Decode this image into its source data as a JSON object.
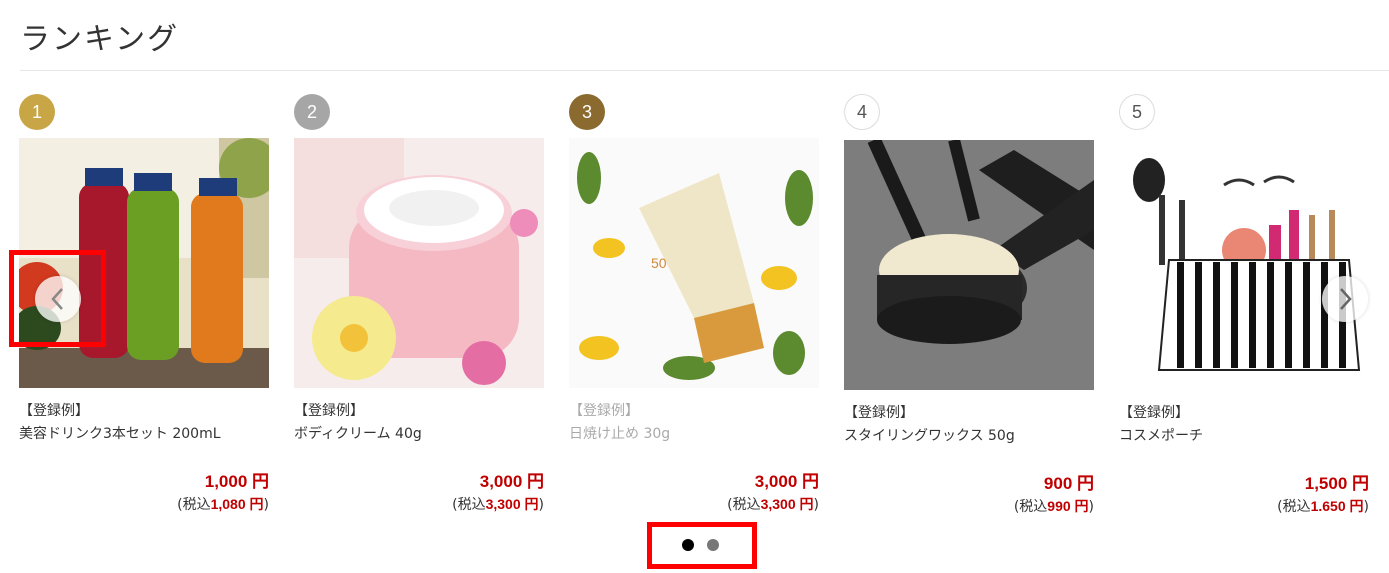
{
  "section": {
    "title": "ランキング"
  },
  "products": [
    {
      "rank": "1",
      "rank_color": "#c8a545",
      "tag": "【登録例】",
      "name": "美容ドリンク3本セット 200mL",
      "price": "1,000 円",
      "tax_prefix": "(税込",
      "tax_value": "1,080 円",
      "tax_suffix": ")"
    },
    {
      "rank": "2",
      "rank_color": "#a6a6a6",
      "tag": "【登録例】",
      "name": "ボディクリーム 40g",
      "price": "3,000 円",
      "tax_prefix": "(税込",
      "tax_value": "3,300 円",
      "tax_suffix": ")"
    },
    {
      "rank": "3",
      "rank_color": "#8a6a2e",
      "tag": "【登録例】",
      "name": "日焼け止め 30g",
      "price": "3,000 円",
      "tax_prefix": "(税込",
      "tax_value": "3,300 円",
      "tax_suffix": ")"
    },
    {
      "rank": "4",
      "rank_color": "#ffffff",
      "tag": "【登録例】",
      "name": "スタイリングワックス 50g",
      "price": "900 円",
      "tax_prefix": "(税込",
      "tax_value": "990 円",
      "tax_suffix": ")"
    },
    {
      "rank": "5",
      "rank_color": "#ffffff",
      "tag": "【登録例】",
      "name": "コスメポーチ",
      "price": "1,500 円",
      "tax_prefix": "(税込",
      "tax_value": "1.650 円",
      "tax_suffix": ")"
    }
  ],
  "carousel": {
    "pages": 2,
    "active_page": 1
  },
  "colors": {
    "price": "#c00000",
    "highlight": "#ff0000"
  }
}
